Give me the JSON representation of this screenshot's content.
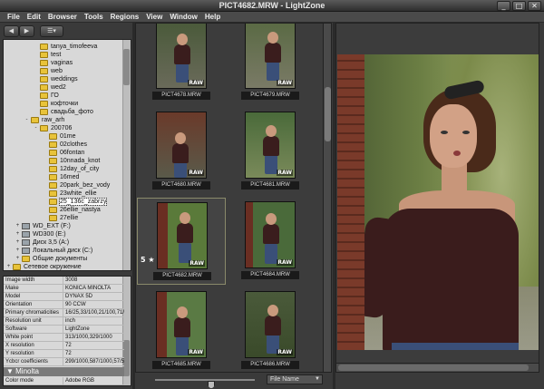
{
  "window": {
    "title": "PICT4682.MRW - LightZone"
  },
  "menu": [
    "File",
    "Edit",
    "Browser",
    "Tools",
    "Regions",
    "View",
    "Window",
    "Help"
  ],
  "toolbar": {
    "back": "◀",
    "forward": "▶",
    "menu": "☰▾"
  },
  "tree": {
    "items": [
      {
        "label": "tanya_timofeeva",
        "depth": 3,
        "kind": "folder",
        "expander": ""
      },
      {
        "label": "test",
        "depth": 3,
        "kind": "folder",
        "expander": ""
      },
      {
        "label": "vaginas",
        "depth": 3,
        "kind": "folder",
        "expander": ""
      },
      {
        "label": "web",
        "depth": 3,
        "kind": "folder",
        "expander": ""
      },
      {
        "label": "weddings",
        "depth": 3,
        "kind": "folder",
        "expander": ""
      },
      {
        "label": "wed2",
        "depth": 3,
        "kind": "folder",
        "expander": ""
      },
      {
        "label": "ГО",
        "depth": 3,
        "kind": "folder",
        "expander": ""
      },
      {
        "label": "кофточки",
        "depth": 3,
        "kind": "folder",
        "expander": ""
      },
      {
        "label": "свадьба_фото",
        "depth": 3,
        "kind": "folder",
        "expander": ""
      },
      {
        "label": "raw_arh",
        "depth": 2,
        "kind": "folder",
        "expander": "-"
      },
      {
        "label": "200706",
        "depth": 3,
        "kind": "folder",
        "expander": "-"
      },
      {
        "label": "01me",
        "depth": 4,
        "kind": "folder",
        "expander": ""
      },
      {
        "label": "02clothes",
        "depth": 4,
        "kind": "folder",
        "expander": ""
      },
      {
        "label": "06fontan",
        "depth": 4,
        "kind": "folder",
        "expander": ""
      },
      {
        "label": "10nnada_knot",
        "depth": 4,
        "kind": "folder",
        "expander": ""
      },
      {
        "label": "12day_of_city",
        "depth": 4,
        "kind": "folder",
        "expander": ""
      },
      {
        "label": "16med",
        "depth": 4,
        "kind": "folder",
        "expander": ""
      },
      {
        "label": "20park_bez_vody",
        "depth": 4,
        "kind": "folder",
        "expander": ""
      },
      {
        "label": "23white_ellie",
        "depth": 4,
        "kind": "folder",
        "expander": ""
      },
      {
        "label": "25_136c_zabrzy",
        "depth": 4,
        "kind": "folder",
        "expander": "",
        "selected": true
      },
      {
        "label": "26ellie_nastya",
        "depth": 4,
        "kind": "folder",
        "expander": ""
      },
      {
        "label": "27ellie",
        "depth": 4,
        "kind": "folder",
        "expander": ""
      },
      {
        "label": "WD_EXT (F:)",
        "depth": 1,
        "kind": "drive",
        "expander": "+"
      },
      {
        "label": "WD300 (E:)",
        "depth": 1,
        "kind": "drive",
        "expander": "+"
      },
      {
        "label": "Диск 3,5 (A:)",
        "depth": 1,
        "kind": "drive",
        "expander": "+"
      },
      {
        "label": "Локальный диск (C:)",
        "depth": 1,
        "kind": "drive",
        "expander": "+"
      },
      {
        "label": "Общие документы",
        "depth": 1,
        "kind": "folder",
        "expander": "+"
      },
      {
        "label": "Сетевое окружение",
        "depth": 0,
        "kind": "folder",
        "expander": "+"
      }
    ]
  },
  "metadata": {
    "rows": [
      {
        "key": "Image width",
        "value": "3008"
      },
      {
        "key": "Make",
        "value": "KONICA MINOLTA"
      },
      {
        "key": "Model",
        "value": "DYNAX 5D"
      },
      {
        "key": "Orientation",
        "value": "90 CCW"
      },
      {
        "key": "Primary chromaticities",
        "value": "16/25,33/100,21/100,71/..."
      },
      {
        "key": "Resolution unit",
        "value": "inch"
      },
      {
        "key": "Software",
        "value": "LightZone"
      },
      {
        "key": "White point",
        "value": "313/1000,329/1000"
      },
      {
        "key": "X resolution",
        "value": "72"
      },
      {
        "key": "Y resolution",
        "value": "72"
      },
      {
        "key": "Ycbcr coefficients",
        "value": "299/1000,587/1000,57/500"
      }
    ],
    "section": "▼  Minolta",
    "section_rows": [
      {
        "key": "Color mode",
        "value": "Adobe RGB"
      }
    ]
  },
  "thumbnails": [
    {
      "caption": "PICT4678.MRW",
      "raw": "RAW",
      "rating": "",
      "selected": false
    },
    {
      "caption": "PICT4679.MRW",
      "raw": "RAW",
      "rating": "",
      "selected": false
    },
    {
      "caption": "PICT4680.MRW",
      "raw": "RAW",
      "rating": "",
      "selected": false
    },
    {
      "caption": "PICT4681.MRW",
      "raw": "RAW",
      "rating": "",
      "selected": false
    },
    {
      "caption": "PICT4682.MRW",
      "raw": "RAW",
      "rating": "5 ★",
      "selected": true
    },
    {
      "caption": "PICT4684.MRW",
      "raw": "RAW",
      "rating": "",
      "selected": false
    },
    {
      "caption": "PICT4685.MRW",
      "raw": "RAW",
      "rating": "",
      "selected": false
    },
    {
      "caption": "PICT4686.MRW",
      "raw": "RAW",
      "rating": "",
      "selected": false
    }
  ],
  "bottombar": {
    "sort_value": "File Name",
    "sort_arrow": "▼"
  },
  "window_buttons": {
    "minimize": "_",
    "maximize": "□",
    "close": "✕"
  },
  "colors": {
    "tree_bg": "#d8d8d8",
    "panel_bg": "#3c3c3c",
    "caption_bg": "#1a1a1a",
    "folder": "#e8c33a"
  }
}
